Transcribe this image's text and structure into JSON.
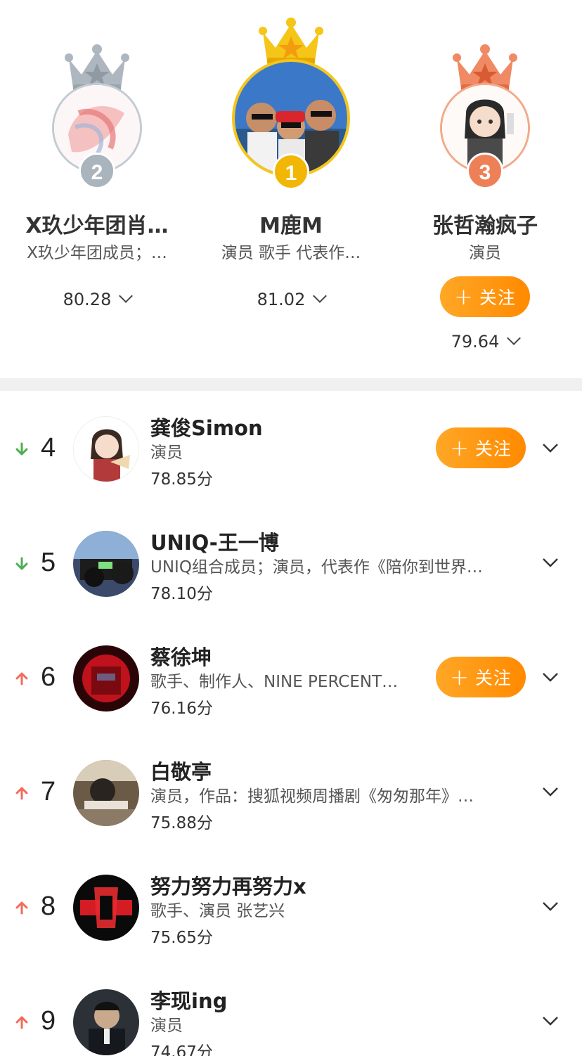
{
  "podium": [
    {
      "rank": "2",
      "name": "X玖少年团肖…",
      "desc": "X玖少年团成员；…",
      "score": "80.28",
      "medal": "silver",
      "crown_color": "#aeb7bf",
      "badge_color": "#aab4bc"
    },
    {
      "rank": "1",
      "name": "M鹿M",
      "desc": "演员  歌手  代表作…",
      "score": "81.02",
      "medal": "gold",
      "crown_color": "#f5c518",
      "badge_color": "#f2b705"
    },
    {
      "rank": "3",
      "name": "张哲瀚疯子",
      "desc": "演员",
      "score": "79.64",
      "medal": "bronze",
      "crown_color": "#f08a64",
      "badge_color": "#ee8058",
      "follow_label": "关注"
    }
  ],
  "list": [
    {
      "rank": "4",
      "trend": "down",
      "name": "龚俊Simon",
      "desc": "演员",
      "score": "78.85分",
      "follow_label": "关注"
    },
    {
      "rank": "5",
      "trend": "down",
      "name": "UNIQ-王一博",
      "desc": "UNIQ组合成员；演员，代表作《陪你到世界…",
      "score": "78.10分"
    },
    {
      "rank": "6",
      "trend": "up",
      "name": "蔡徐坤",
      "desc": "歌手、制作人、NINE PERCENT…",
      "score": "76.16分",
      "follow_label": "关注"
    },
    {
      "rank": "7",
      "trend": "up",
      "name": "白敬亭",
      "desc": "演员，作品：搜狐视频周播剧《匆匆那年》…",
      "score": "75.88分"
    },
    {
      "rank": "8",
      "trend": "up",
      "name": "努力努力再努力x",
      "desc": "歌手、演员 张艺兴",
      "score": "75.65分"
    },
    {
      "rank": "9",
      "trend": "up",
      "name": "李现ing",
      "desc": "演员",
      "score": "74.67分"
    }
  ],
  "colors": {
    "accent_orange": "#ff9800",
    "trend_up": "#f26b5b",
    "trend_down": "#4caf50"
  }
}
